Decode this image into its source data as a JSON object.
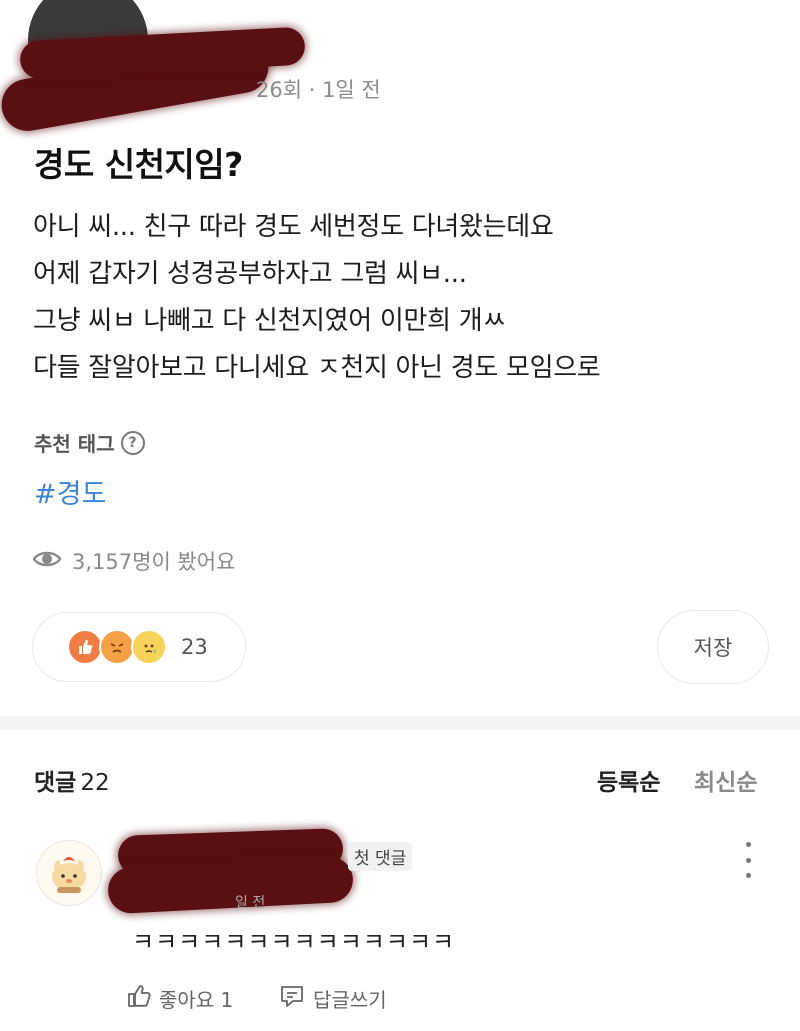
{
  "post": {
    "meta": "26회 · 1일 전",
    "title": "경도 신천지임?",
    "body": [
      "아니 씨... 친구 따라 경도 세번정도 다녀왔는데요",
      "어제 갑자기 성경공부하자고 그럼 씨ㅂ...",
      "그냥 씨ㅂ 나빼고 다 신천지였어 이만희 개ㅆ",
      "다들 잘알아보고 다니세요 ㅈ천지 아닌 경도 모임으로"
    ],
    "tag_label": "추천 태그",
    "tag": "#경도",
    "views": "3,157명이 봤어요",
    "reaction_count": "23",
    "save_label": "저장"
  },
  "comments": {
    "label": "댓글",
    "count": "22",
    "sort_registered": "등록순",
    "sort_latest": "최신순",
    "items": [
      {
        "badge": "첫 댓글",
        "time_fragment": "일 전",
        "text": "ㅋㅋㅋㅋㅋㅋㅋㅋㅋㅋㅋㅋㅋㅋ",
        "like_label": "좋아요 1",
        "reply_label": "답글쓰기"
      }
    ]
  },
  "icons": {
    "views": "eye-icon",
    "help": "question-circle-icon",
    "like": "thumbs-up-icon",
    "reply": "reply-icon",
    "more": "more-vertical-icon"
  },
  "colors": {
    "tag": "#3b84d6",
    "muted": "#8a8a8a",
    "redaction": "#5a0f12"
  }
}
